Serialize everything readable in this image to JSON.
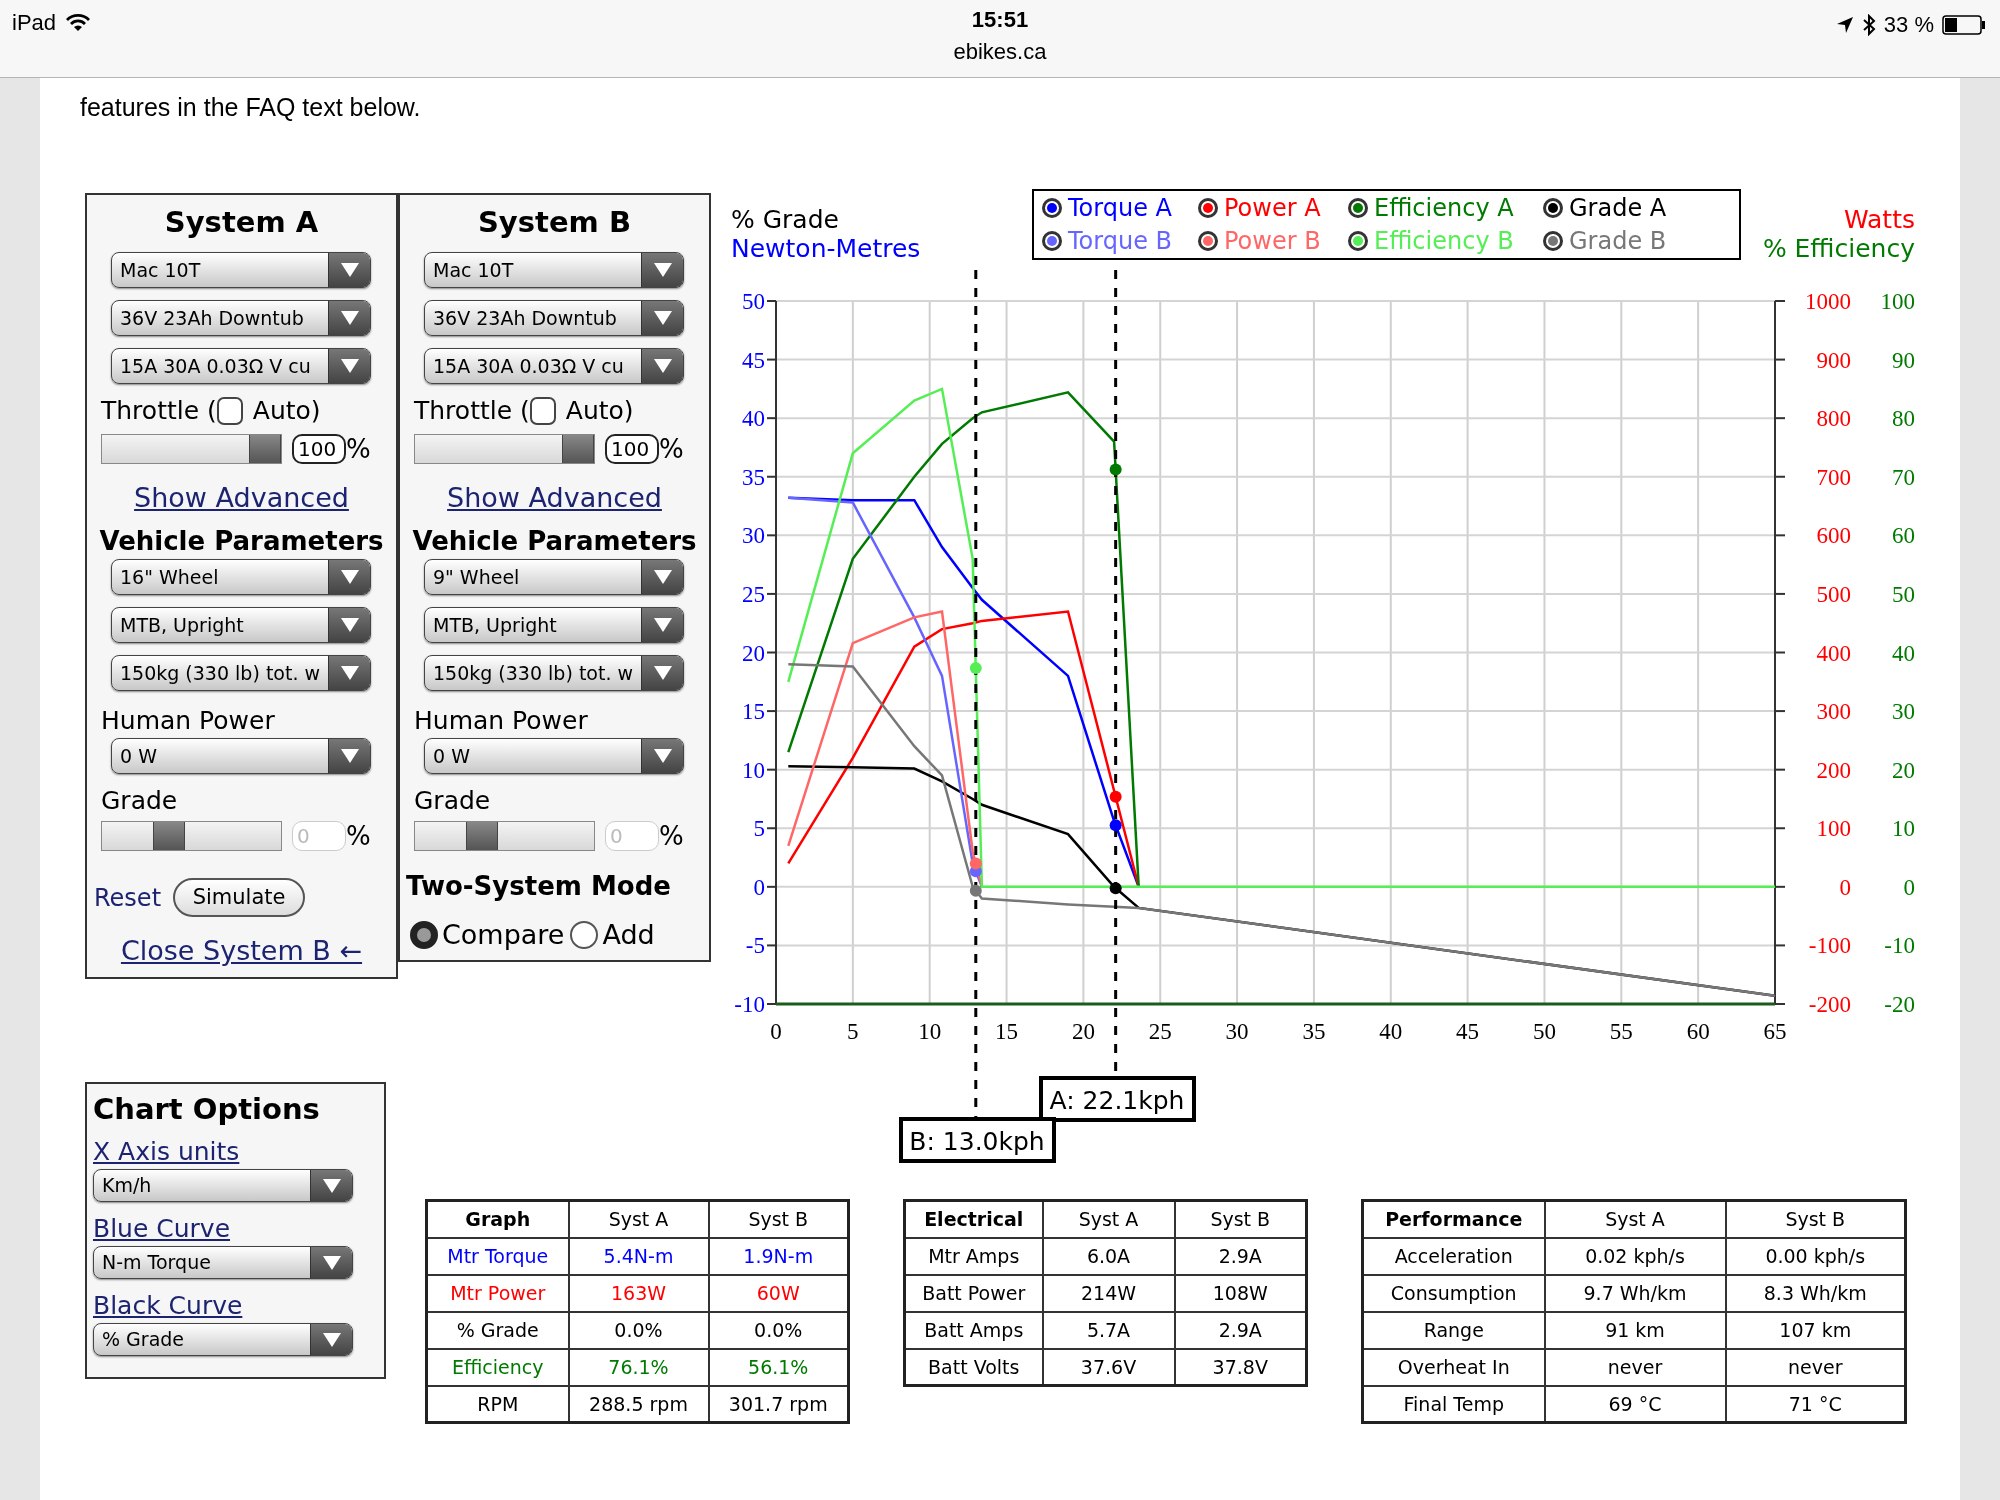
{
  "status_bar": {
    "device": "iPad",
    "time": "15:51",
    "url": "ebikes.ca",
    "battery": "33 %"
  },
  "intro": "features in the FAQ text below.",
  "systems": [
    {
      "title": "System A",
      "selects": [
        "Mac 10T",
        "36V 23Ah Downtub",
        "15A 30A 0.03Ω V cu"
      ],
      "throttle_label": "Throttle (",
      "auto_label": "Auto)",
      "auto_checked": false,
      "throttle": {
        "level": 1,
        "value": "100",
        "unit": "%"
      },
      "advanced_link": "Show Advanced",
      "vehicle_title": "Vehicle Parameters",
      "vehicle_selects": [
        "16\"  Wheel",
        "MTB, Upright",
        "150kg (330 lb) tot. w"
      ],
      "human_power_label": "Human Power",
      "human_power": "0 W",
      "grade_label": "Grade",
      "grade": {
        "level": 0.35,
        "placeholder": "0",
        "unit": "%"
      },
      "footer": {
        "kind": "actions",
        "reset": "Reset",
        "simulate": "Simulate",
        "close": "Close System B ←"
      }
    },
    {
      "title": "System B",
      "selects": [
        "Mac 10T",
        "36V 23Ah Downtub",
        "15A 30A 0.03Ω V cu"
      ],
      "throttle_label": "Throttle (",
      "auto_label": "Auto)",
      "auto_checked": false,
      "throttle": {
        "level": 1,
        "value": "100",
        "unit": "%"
      },
      "advanced_link": "Show Advanced",
      "vehicle_title": "Vehicle Parameters",
      "vehicle_selects": [
        "9\"  Wheel",
        "MTB, Upright",
        "150kg (330 lb) tot. w"
      ],
      "human_power_label": "Human Power",
      "human_power": "0 W",
      "grade_label": "Grade",
      "grade": {
        "level": 0.35,
        "placeholder": "0",
        "unit": "%"
      },
      "footer": {
        "kind": "mode",
        "title": "Two-System Mode",
        "options": [
          {
            "label": "Compare",
            "selected": true
          },
          {
            "label": "Add",
            "selected": false
          }
        ]
      }
    }
  ],
  "chart": {
    "left_axis_titles": [
      {
        "text": "% Grade",
        "color": "#000000"
      },
      {
        "text": "Newton-Metres",
        "color": "#0000ff"
      }
    ],
    "right_axis_titles": [
      {
        "text": "Watts",
        "color": "#ff0000"
      },
      {
        "text": "% Efficiency",
        "color": "#007a00"
      }
    ],
    "watts_ticks": [
      "1000",
      "900",
      "800",
      "700",
      "600",
      "500",
      "400",
      "300",
      "200",
      "100",
      "0",
      "-100",
      "-200"
    ],
    "efficiency_ticks": [
      "100",
      "90",
      "80",
      "70",
      "60",
      "50",
      "40",
      "30",
      "20",
      "10",
      "0",
      "-10",
      "-20"
    ],
    "chart_data": {
      "type": "line",
      "x": [
        0.8,
        5,
        9,
        10.8,
        12.8,
        13.4,
        19,
        22,
        23.6,
        65
      ],
      "series": [
        {
          "name": "Torque A",
          "color": "#0000ff",
          "values": [
            33.2,
            33,
            33,
            29,
            25.5,
            24.5,
            18,
            5.6,
            0,
            null
          ]
        },
        {
          "name": "Power A",
          "color": "#ff0000",
          "values": [
            2,
            11,
            20.5,
            22,
            22.5,
            22.7,
            23.5,
            8.2,
            0,
            null
          ]
        },
        {
          "name": "Efficiency A",
          "color": "#007a00",
          "values": [
            11.5,
            28,
            35,
            37.8,
            40,
            40.5,
            42.2,
            38,
            0,
            null
          ]
        },
        {
          "name": "Grade A",
          "color": "#000000",
          "values": [
            10.3,
            10.2,
            10.1,
            9,
            7.5,
            7,
            4.5,
            0,
            -1.8,
            -9.3
          ]
        },
        {
          "name": "Torque B",
          "color": "#6666ff",
          "values": [
            33.2,
            32.8,
            23,
            18,
            2,
            0,
            null,
            null,
            null,
            null
          ]
        },
        {
          "name": "Power B",
          "color": "#ff6666",
          "values": [
            3.5,
            20.8,
            23,
            23.5,
            3,
            0,
            null,
            null,
            null,
            null
          ]
        },
        {
          "name": "Efficiency B",
          "color": "#55ee55",
          "values": [
            17.5,
            37,
            41.5,
            42.5,
            28,
            0,
            0,
            0,
            0,
            0
          ]
        },
        {
          "name": "Grade B",
          "color": "#777777",
          "values": [
            19,
            18.8,
            12,
            9.5,
            0,
            -1,
            -1.5,
            -1.7,
            -1.8,
            -9.3
          ]
        }
      ],
      "xlim": [
        0,
        65
      ],
      "ylim": [
        -10,
        50
      ],
      "xticks": [
        0,
        5,
        10,
        15,
        20,
        25,
        30,
        35,
        40,
        45,
        50,
        55,
        60,
        65
      ],
      "yticks": [
        -10,
        -5,
        0,
        5,
        10,
        15,
        20,
        25,
        30,
        35,
        40,
        45,
        50
      ],
      "grid": true,
      "ref_lines": [
        {
          "axis": "x",
          "value": 22.1,
          "label": "A: 22.1kph"
        },
        {
          "axis": "x",
          "value": 13.0,
          "label": "B: 13.0kph"
        }
      ]
    }
  },
  "chart_options": {
    "title": "Chart Options",
    "fields": [
      {
        "label": "X Axis units",
        "value": "Km/h"
      },
      {
        "label": "Blue Curve",
        "value": "N-m Torque"
      },
      {
        "label": "Black Curve",
        "value": "% Grade"
      }
    ]
  },
  "tables": [
    {
      "columns": [
        "Graph",
        "Syst A",
        "Syst B"
      ],
      "rows": [
        {
          "cells": [
            "Mtr Torque",
            "5.4N-m",
            "1.9N-m"
          ],
          "color": "#0000ff"
        },
        {
          "cells": [
            "Mtr Power",
            "163W",
            "60W"
          ],
          "color": "#ff0000"
        },
        {
          "cells": [
            "% Grade",
            "0.0%",
            "0.0%"
          ],
          "color": "#000000"
        },
        {
          "cells": [
            "Efficiency",
            "76.1%",
            "56.1%"
          ],
          "color": "#007a00"
        },
        {
          "cells": [
            "RPM",
            "288.5 rpm",
            "301.7 rpm"
          ],
          "color": "#000000"
        }
      ]
    },
    {
      "columns": [
        "Electrical",
        "Syst A",
        "Syst B"
      ],
      "rows": [
        {
          "cells": [
            "Mtr Amps",
            "6.0A",
            "2.9A"
          ],
          "color": "#000000"
        },
        {
          "cells": [
            "Batt Power",
            "214W",
            "108W"
          ],
          "color": "#000000"
        },
        {
          "cells": [
            "Batt Amps",
            "5.7A",
            "2.9A"
          ],
          "color": "#000000"
        },
        {
          "cells": [
            "Batt Volts",
            "37.6V",
            "37.8V"
          ],
          "color": "#000000"
        }
      ]
    },
    {
      "columns": [
        "Performance",
        "Syst A",
        "Syst B"
      ],
      "rows": [
        {
          "cells": [
            "Acceleration",
            "0.02 kph/s",
            "0.00 kph/s"
          ],
          "color": "#000000"
        },
        {
          "cells": [
            "Consumption",
            "9.7 Wh/km",
            "8.3 Wh/km"
          ],
          "color": "#000000"
        },
        {
          "cells": [
            "Range",
            "91 km",
            "107 km"
          ],
          "color": "#000000"
        },
        {
          "cells": [
            "Overheat In",
            "never",
            "never"
          ],
          "color": "#000000"
        },
        {
          "cells": [
            "Final Temp",
            "69 °C",
            "71 °C"
          ],
          "color": "#000000"
        }
      ]
    }
  ]
}
